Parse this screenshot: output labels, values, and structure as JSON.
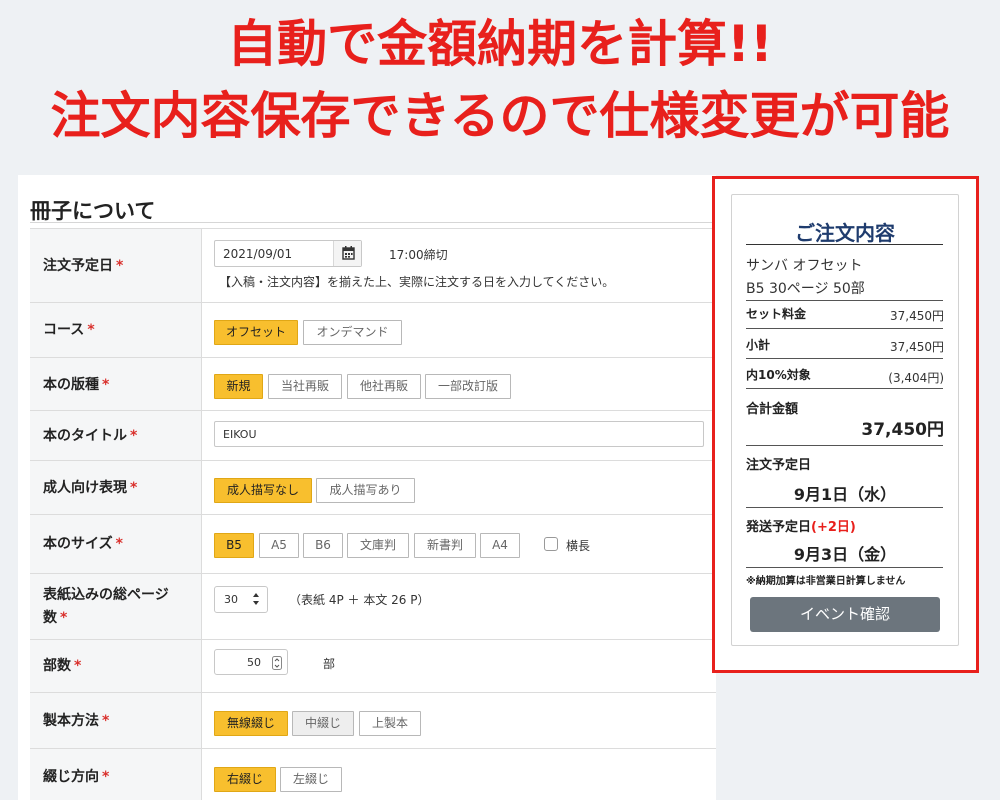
{
  "headline": {
    "line1": "自動で金額納期を計算!!",
    "line2": "注文内容保存できるので仕様変更が可能"
  },
  "form": {
    "section_title": "冊子について",
    "required_mark": "*",
    "order_date": {
      "label": "注文予定日",
      "value": "2021/09/01",
      "deadline": "17:00締切",
      "help": "【入稿・注文内容】を揃えた上、実際に注文する日を入力してください。",
      "icon": "calendar-icon"
    },
    "course": {
      "label": "コース",
      "options": [
        "オフセット",
        "オンデマンド"
      ],
      "selected": "オフセット"
    },
    "edition": {
      "label": "本の版種",
      "options": [
        "新規",
        "当社再販",
        "他社再販",
        "一部改訂版"
      ],
      "selected": "新規"
    },
    "title": {
      "label": "本のタイトル",
      "value": "EIKOU"
    },
    "adult": {
      "label": "成人向け表現",
      "options": [
        "成人描写なし",
        "成人描写あり"
      ],
      "selected": "成人描写なし"
    },
    "size": {
      "label": "本のサイズ",
      "options": [
        "B5",
        "A5",
        "B6",
        "文庫判",
        "新書判",
        "A4"
      ],
      "selected": "B5",
      "landscape_label": "横長",
      "landscape_checked": false
    },
    "pages": {
      "label_line1": "表紙込みの総ページ",
      "label_line2": "数",
      "value": "30",
      "detail": "（表紙 4P ＋ 本文 26 P）"
    },
    "copies": {
      "label": "部数",
      "value": "50",
      "unit": "部"
    },
    "binding": {
      "label": "製本方法",
      "options": [
        "無線綴じ",
        "中綴じ",
        "上製本"
      ],
      "selected": "無線綴じ"
    },
    "direction": {
      "label": "綴じ方向",
      "options": [
        "右綴じ",
        "左綴じ"
      ],
      "selected": "右綴じ"
    }
  },
  "summary": {
    "title": "ご注文内容",
    "product": "サンバ オフセット",
    "spec": "B5  30ページ  50部",
    "set_price_label": "セット料金",
    "set_price": "37,450円",
    "subtotal_label": "小計",
    "subtotal": "37,450円",
    "tax_label": "内10%対象",
    "tax": "(3,404円)",
    "total_label": "合計金額",
    "total": "37,450円",
    "order_date_label": "注文予定日",
    "order_date": "9月1日（水）",
    "ship_label": "発送予定日",
    "ship_extra": "(+2日)",
    "ship_date": "9月3日（金）",
    "note": "※納期加算は非営業日計算しません",
    "event_button": "イベント確認"
  },
  "colors": {
    "headline_red": "#e8201c",
    "selected_option": "#f8bf2e",
    "summary_title": "#1f3c6e",
    "event_button": "#6c757d"
  }
}
